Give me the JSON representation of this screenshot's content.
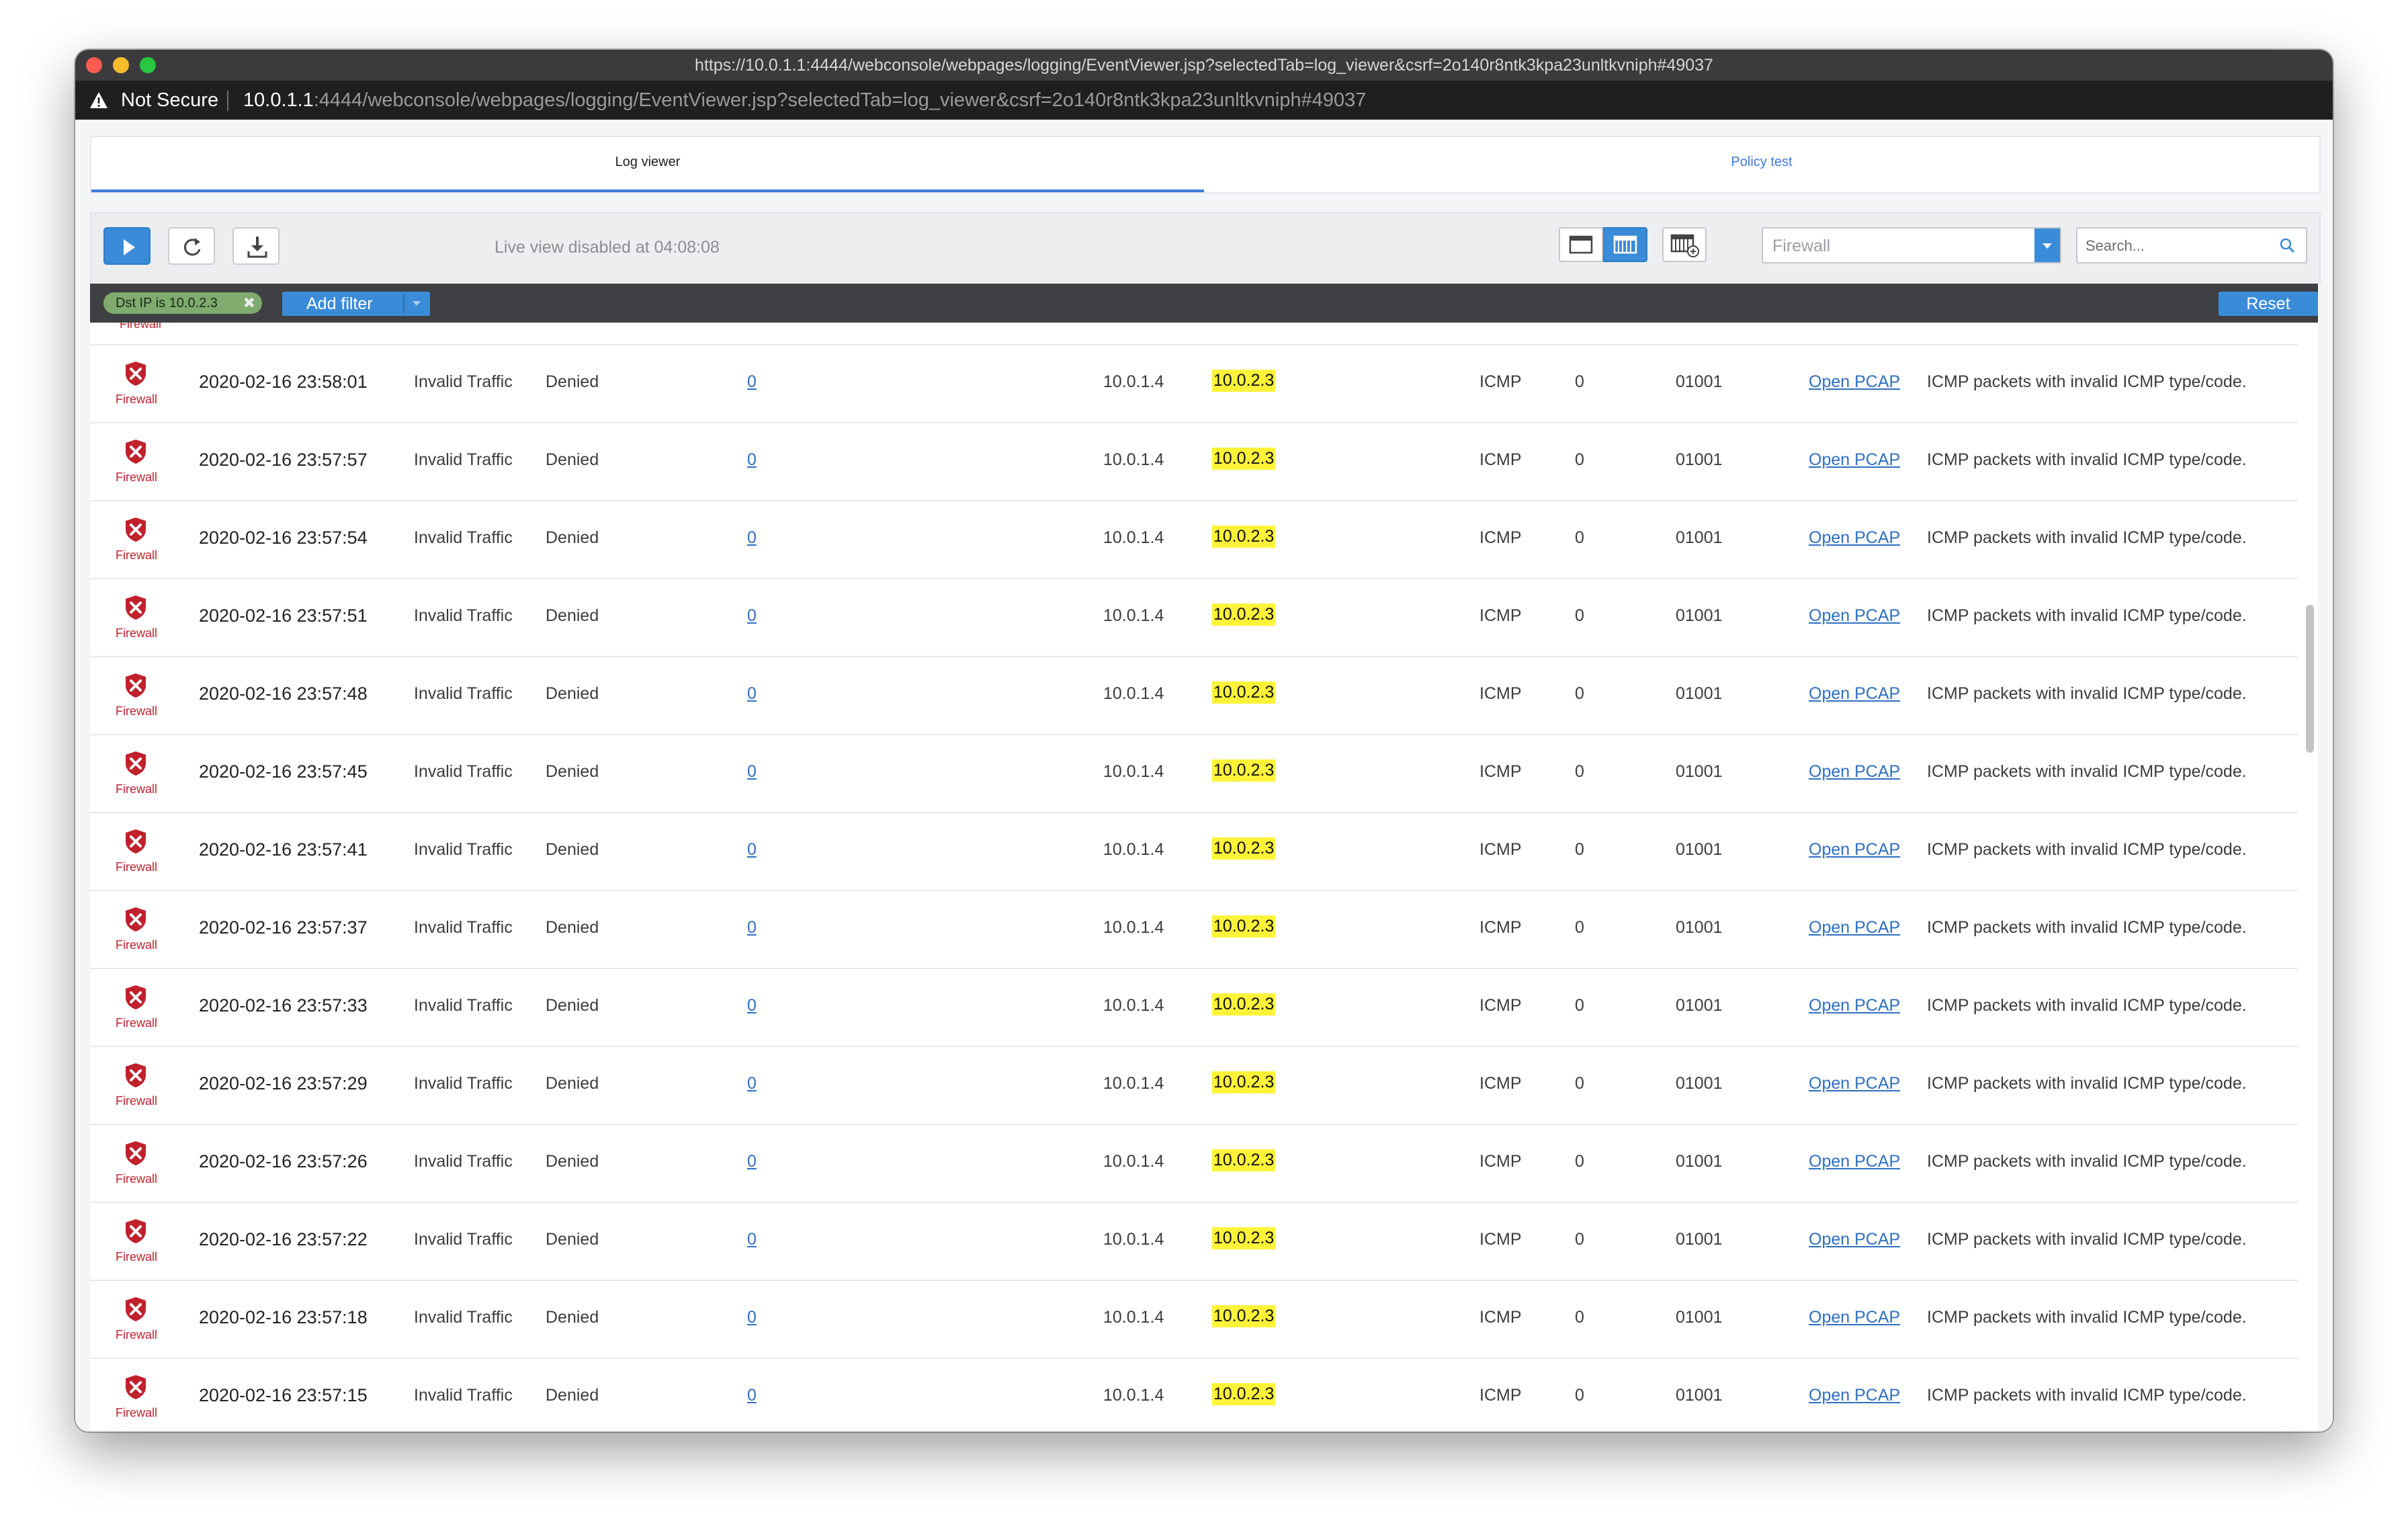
{
  "window": {
    "title_url": "https://10.0.1.1:4444/webconsole/webpages/logging/EventViewer.jsp?selectedTab=log_viewer&csrf=2o140r8ntk3kpa23unltkvniph#49037"
  },
  "addressbar": {
    "security_label": "Not Secure",
    "host": "10.0.1.1",
    "path": ":4444/webconsole/webpages/logging/EventViewer.jsp?selectedTab=log_viewer&csrf=2o140r8ntk3kpa23unltkvniph#49037"
  },
  "tabs": [
    {
      "label": "Log viewer",
      "active": true
    },
    {
      "label": "Policy test",
      "active": false
    }
  ],
  "toolbar": {
    "live_status": "Live view disabled at 04:08:08",
    "module_select": "Firewall",
    "search_placeholder": "Search..."
  },
  "filterbar": {
    "chip_label": "Dst IP is 10.0.2.3",
    "chip_remove": "✖",
    "add_filter_label": "Add filter",
    "reset_label": "Reset"
  },
  "table": {
    "partial_row_label": "Firewall",
    "rows": [
      {
        "module": "Firewall",
        "time": "2020-02-16 23:58:01",
        "category": "Invalid Traffic",
        "action": "Denied",
        "link": "0",
        "src_ip": "10.0.1.4",
        "dst_ip": "10.0.2.3",
        "protocol": "ICMP",
        "count": "0",
        "code": "01001",
        "pcap": "Open PCAP",
        "message": "ICMP packets with invalid ICMP type/code."
      },
      {
        "module": "Firewall",
        "time": "2020-02-16 23:57:57",
        "category": "Invalid Traffic",
        "action": "Denied",
        "link": "0",
        "src_ip": "10.0.1.4",
        "dst_ip": "10.0.2.3",
        "protocol": "ICMP",
        "count": "0",
        "code": "01001",
        "pcap": "Open PCAP",
        "message": "ICMP packets with invalid ICMP type/code."
      },
      {
        "module": "Firewall",
        "time": "2020-02-16 23:57:54",
        "category": "Invalid Traffic",
        "action": "Denied",
        "link": "0",
        "src_ip": "10.0.1.4",
        "dst_ip": "10.0.2.3",
        "protocol": "ICMP",
        "count": "0",
        "code": "01001",
        "pcap": "Open PCAP",
        "message": "ICMP packets with invalid ICMP type/code."
      },
      {
        "module": "Firewall",
        "time": "2020-02-16 23:57:51",
        "category": "Invalid Traffic",
        "action": "Denied",
        "link": "0",
        "src_ip": "10.0.1.4",
        "dst_ip": "10.0.2.3",
        "protocol": "ICMP",
        "count": "0",
        "code": "01001",
        "pcap": "Open PCAP",
        "message": "ICMP packets with invalid ICMP type/code."
      },
      {
        "module": "Firewall",
        "time": "2020-02-16 23:57:48",
        "category": "Invalid Traffic",
        "action": "Denied",
        "link": "0",
        "src_ip": "10.0.1.4",
        "dst_ip": "10.0.2.3",
        "protocol": "ICMP",
        "count": "0",
        "code": "01001",
        "pcap": "Open PCAP",
        "message": "ICMP packets with invalid ICMP type/code."
      },
      {
        "module": "Firewall",
        "time": "2020-02-16 23:57:45",
        "category": "Invalid Traffic",
        "action": "Denied",
        "link": "0",
        "src_ip": "10.0.1.4",
        "dst_ip": "10.0.2.3",
        "protocol": "ICMP",
        "count": "0",
        "code": "01001",
        "pcap": "Open PCAP",
        "message": "ICMP packets with invalid ICMP type/code."
      },
      {
        "module": "Firewall",
        "time": "2020-02-16 23:57:41",
        "category": "Invalid Traffic",
        "action": "Denied",
        "link": "0",
        "src_ip": "10.0.1.4",
        "dst_ip": "10.0.2.3",
        "protocol": "ICMP",
        "count": "0",
        "code": "01001",
        "pcap": "Open PCAP",
        "message": "ICMP packets with invalid ICMP type/code."
      },
      {
        "module": "Firewall",
        "time": "2020-02-16 23:57:37",
        "category": "Invalid Traffic",
        "action": "Denied",
        "link": "0",
        "src_ip": "10.0.1.4",
        "dst_ip": "10.0.2.3",
        "protocol": "ICMP",
        "count": "0",
        "code": "01001",
        "pcap": "Open PCAP",
        "message": "ICMP packets with invalid ICMP type/code."
      },
      {
        "module": "Firewall",
        "time": "2020-02-16 23:57:33",
        "category": "Invalid Traffic",
        "action": "Denied",
        "link": "0",
        "src_ip": "10.0.1.4",
        "dst_ip": "10.0.2.3",
        "protocol": "ICMP",
        "count": "0",
        "code": "01001",
        "pcap": "Open PCAP",
        "message": "ICMP packets with invalid ICMP type/code."
      },
      {
        "module": "Firewall",
        "time": "2020-02-16 23:57:29",
        "category": "Invalid Traffic",
        "action": "Denied",
        "link": "0",
        "src_ip": "10.0.1.4",
        "dst_ip": "10.0.2.3",
        "protocol": "ICMP",
        "count": "0",
        "code": "01001",
        "pcap": "Open PCAP",
        "message": "ICMP packets with invalid ICMP type/code."
      },
      {
        "module": "Firewall",
        "time": "2020-02-16 23:57:26",
        "category": "Invalid Traffic",
        "action": "Denied",
        "link": "0",
        "src_ip": "10.0.1.4",
        "dst_ip": "10.0.2.3",
        "protocol": "ICMP",
        "count": "0",
        "code": "01001",
        "pcap": "Open PCAP",
        "message": "ICMP packets with invalid ICMP type/code."
      },
      {
        "module": "Firewall",
        "time": "2020-02-16 23:57:22",
        "category": "Invalid Traffic",
        "action": "Denied",
        "link": "0",
        "src_ip": "10.0.1.4",
        "dst_ip": "10.0.2.3",
        "protocol": "ICMP",
        "count": "0",
        "code": "01001",
        "pcap": "Open PCAP",
        "message": "ICMP packets with invalid ICMP type/code."
      },
      {
        "module": "Firewall",
        "time": "2020-02-16 23:57:18",
        "category": "Invalid Traffic",
        "action": "Denied",
        "link": "0",
        "src_ip": "10.0.1.4",
        "dst_ip": "10.0.2.3",
        "protocol": "ICMP",
        "count": "0",
        "code": "01001",
        "pcap": "Open PCAP",
        "message": "ICMP packets with invalid ICMP type/code."
      },
      {
        "module": "Firewall",
        "time": "2020-02-16 23:57:15",
        "category": "Invalid Traffic",
        "action": "Denied",
        "link": "0",
        "src_ip": "10.0.1.4",
        "dst_ip": "10.0.2.3",
        "protocol": "ICMP",
        "count": "0",
        "code": "01001",
        "pcap": "Open PCAP",
        "message": "ICMP packets with invalid ICMP type/code."
      }
    ]
  },
  "icons": {
    "warning": "warning-triangle-icon",
    "play": "play-icon",
    "refresh": "refresh-icon",
    "download": "download-icon",
    "view_single": "layout-single-icon",
    "view_columns": "layout-columns-icon",
    "view_add": "add-column-icon",
    "search": "search-icon",
    "firewall": "shield-x-icon"
  },
  "colors": {
    "accent": "#3a8cd9",
    "highlight": "#fff33a",
    "firewall_red": "#c0212c",
    "filter_chip": "#7fab6e"
  }
}
